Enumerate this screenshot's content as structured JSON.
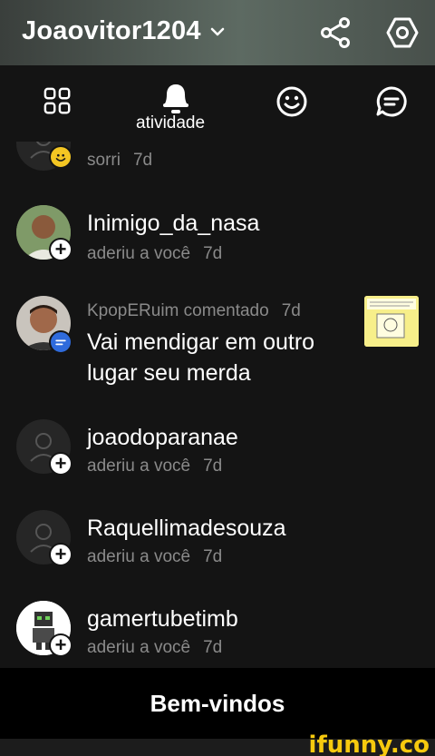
{
  "header": {
    "title": "Joaovitor1204",
    "share_icon": "share-icon",
    "settings_icon": "settings-icon"
  },
  "tabs": {
    "active_label": "atividade",
    "icons": [
      "grid-icon",
      "bell-icon",
      "smiley-icon",
      "chat-icon"
    ]
  },
  "feed": [
    {
      "name": "",
      "action": "sorri",
      "time": "7d",
      "badge": "smile",
      "has_thumb": true
    },
    {
      "name": "Inimigo_da_nasa",
      "action": "aderiu a você",
      "time": "7d",
      "badge": "follow"
    },
    {
      "name": "KpopERuim",
      "action": "comentado",
      "time": "7d",
      "badge": "comment",
      "comment": "Vai mendigar em outro lugar seu merda",
      "has_thumb": true
    },
    {
      "name": "joaodoparanae",
      "action": "aderiu a você",
      "time": "7d",
      "badge": "follow"
    },
    {
      "name": "Raquellimadesouza",
      "action": "aderiu a você",
      "time": "7d",
      "badge": "follow"
    },
    {
      "name": "gamertubetimb",
      "action": "aderiu a você",
      "time": "7d",
      "badge": "follow"
    }
  ],
  "footer": {
    "label": "Bem-vindos"
  },
  "watermark": "ifunny.co",
  "colors": {
    "accent_blue": "#2f6bdc",
    "smile_yellow": "#f3c623",
    "watermark_yellow": "#f6c90e"
  }
}
